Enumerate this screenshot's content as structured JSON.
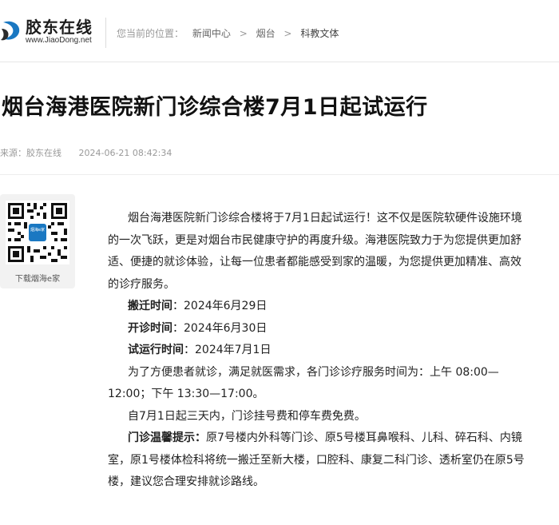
{
  "header": {
    "logo_name": "胶东在线",
    "logo_url": "www.JiaoDong.net",
    "breadcrumb": {
      "prefix": "您当前的位置：",
      "items": [
        "新闻中心",
        "烟台",
        "科教文体"
      ],
      "separator": ">"
    }
  },
  "article": {
    "title": "烟台海港医院新门诊综合楼7月1日起试运行",
    "source": "来源：胶东在线",
    "datetime": "2024-06-21 08:42:34",
    "intro": "烟台海港医院新门诊综合楼将于7月1日起试运行！这不仅是医院软硬件设施环境的一次飞跃，更是对烟台市民健康守护的再度升级。海港医院致力于为您提供更加舒适、便捷的就诊体验，让每一位患者都能感受到家的温暖，为您提供更加精准、高效的诊疗服务。",
    "move_label": "搬迁时间",
    "move_value": "：2024年6月29日",
    "open_label": "开诊时间",
    "open_value": "：2024年6月30日",
    "trial_label": "试运行时间",
    "trial_value": "：2024年7月1日",
    "hours": "为了方便患者就诊，满足就医需求，各门诊诊疗服务时间为：上午 08:00—12:00；下午 13:30—17:00。",
    "free": "自7月1日起三天内，门诊挂号费和停车费免费。",
    "tip_label": "门诊温馨提示：",
    "tip_text": "原7号楼内外科等门诊、原5号楼耳鼻喉科、儿科、碎石科、内镜室，原1号楼体检科将统一搬迁至新大楼，口腔科、康复二科门诊、透析室仍在原5号楼，建议您合理安排就诊路线。"
  },
  "sidebar": {
    "qr_caption": "下载烟海e家",
    "qr_center_text": "烟海e家"
  },
  "colors": {
    "brand_blue": "#1a78c2",
    "text_main": "#222222",
    "text_muted": "#999999"
  }
}
